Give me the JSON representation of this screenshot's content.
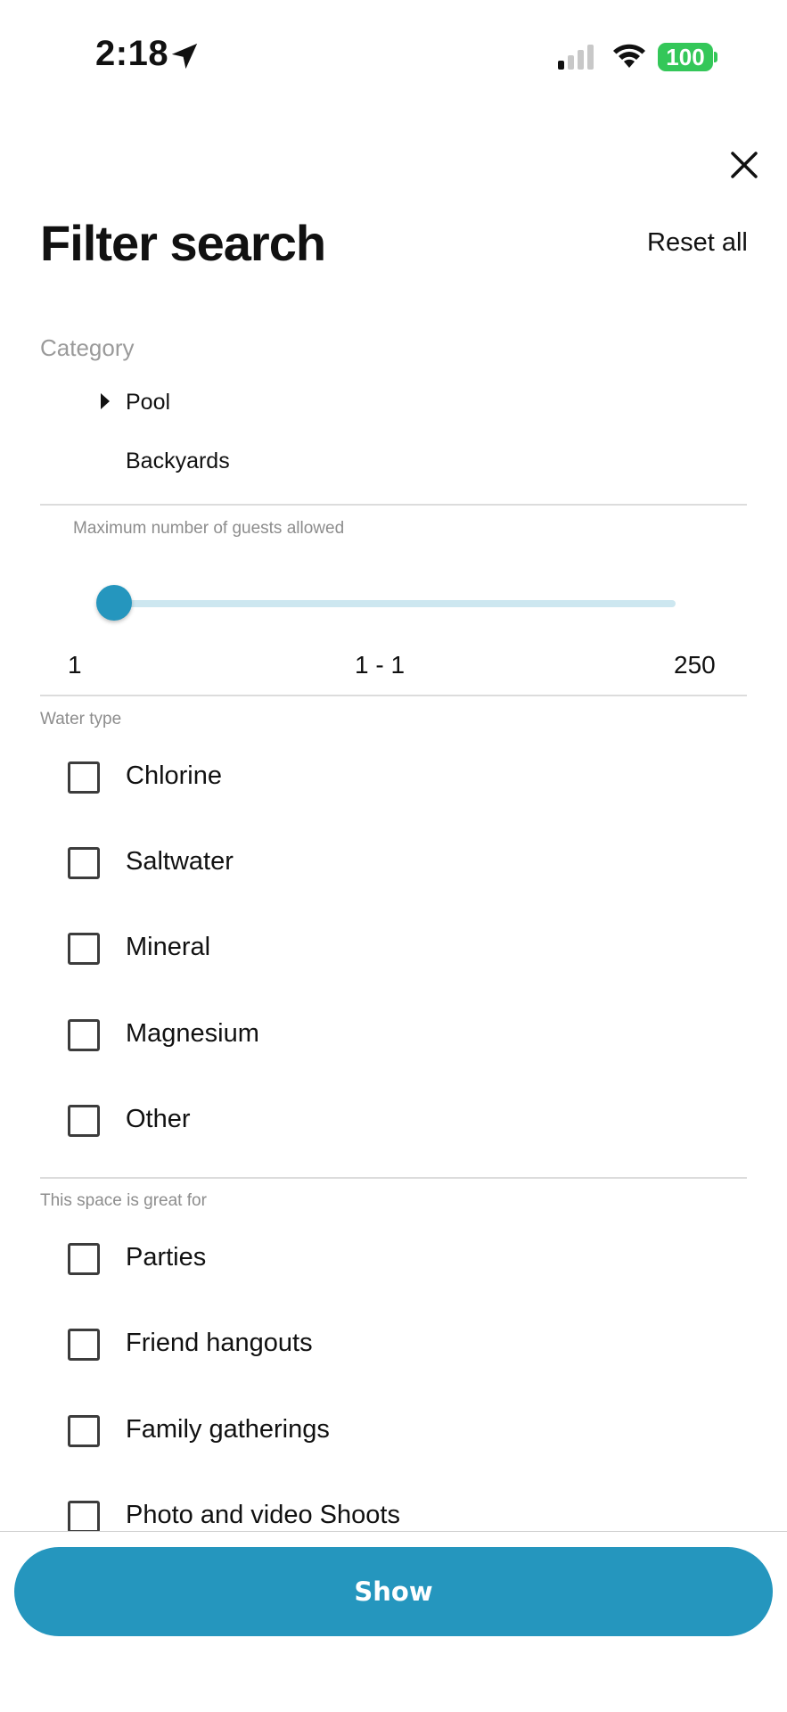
{
  "status_bar": {
    "time": "2:18",
    "battery": "100",
    "location_icon": "location-arrow-icon",
    "signal_icon": "cellular-signal-icon",
    "wifi_icon": "wifi-icon"
  },
  "header": {
    "title": "Filter search",
    "reset_label": "Reset all",
    "close_icon": "close-icon"
  },
  "category": {
    "label": "Category",
    "items": [
      {
        "label": "Pool",
        "expanded_icon": "caret-right-icon"
      },
      {
        "label": "Backyards"
      }
    ]
  },
  "guests": {
    "label": "Maximum number of guests allowed",
    "min": "1",
    "range": "1 - 1",
    "max": "250",
    "slider_value_fraction": 0
  },
  "water_type": {
    "label": "Water type",
    "options": [
      {
        "label": "Chlorine",
        "checked": false
      },
      {
        "label": "Saltwater",
        "checked": false
      },
      {
        "label": "Mineral",
        "checked": false
      },
      {
        "label": "Magnesium",
        "checked": false
      },
      {
        "label": "Other",
        "checked": false
      }
    ]
  },
  "great_for": {
    "label": "This space is great for",
    "options": [
      {
        "label": "Parties",
        "checked": false
      },
      {
        "label": "Friend hangouts",
        "checked": false
      },
      {
        "label": "Family gatherings",
        "checked": false
      },
      {
        "label": "Photo and video Shoots",
        "checked": false
      }
    ]
  },
  "footer": {
    "show_label": "Show"
  },
  "colors": {
    "accent": "#2596be",
    "slider_track": "#cde7f0",
    "battery": "#34c759"
  }
}
